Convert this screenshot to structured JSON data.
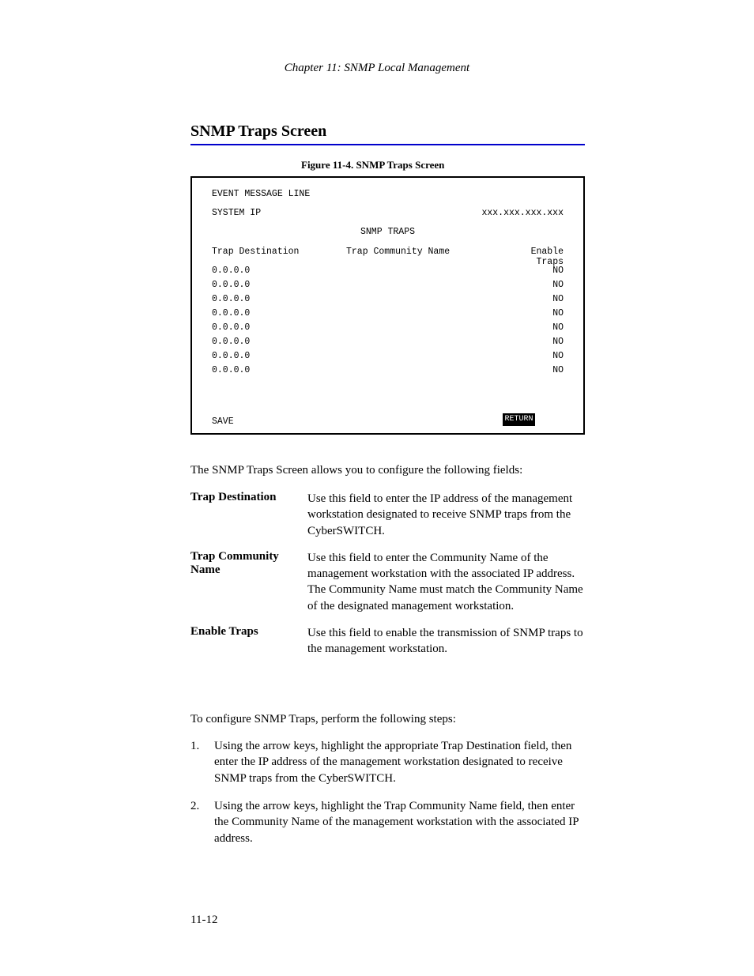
{
  "header": {
    "running": "Chapter 11:  SNMP Local Management"
  },
  "section_title": "SNMP Traps Screen",
  "figure": {
    "caption": "Figure 11-4.  SNMP Traps Screen"
  },
  "screen": {
    "event_message": "EVENT MESSAGE LINE",
    "system_line": {
      "left": "SYSTEM IP",
      "right": "xxx.xxx.xxx.xxx"
    },
    "title_line": "SNMP TRAPS",
    "col_headers": {
      "left": "Trap Destination",
      "mid": "Trap Community Name",
      "right": "Enable Traps"
    },
    "rows": [
      {
        "left": "0.0.0.0",
        "right": "NO"
      },
      {
        "left": "0.0.0.0",
        "right": "NO"
      },
      {
        "left": "0.0.0.0",
        "right": "NO"
      },
      {
        "left": "0.0.0.0",
        "right": "NO"
      },
      {
        "left": "0.0.0.0",
        "right": "NO"
      },
      {
        "left": "0.0.0.0",
        "right": "NO"
      },
      {
        "left": "0.0.0.0",
        "right": "NO"
      },
      {
        "left": "0.0.0.0",
        "right": "NO"
      }
    ],
    "footer_save": "SAVE",
    "return_btn": "RETURN"
  },
  "body": {
    "p1": "The SNMP Traps Screen allows you to configure the following fields:",
    "fields": [
      {
        "label": "Trap Destination",
        "desc": "Use this field to enter the IP address of the management workstation designated to receive SNMP traps from the CyberSWITCH."
      },
      {
        "label": "Trap Community Name",
        "desc": "Use this field to enter the Community Name of the management workstation with the associated IP address. The Community Name must match the Community Name of the designated management workstation."
      },
      {
        "label": "Enable Traps",
        "desc": "Use this field to enable the transmission of SNMP traps to the management workstation."
      }
    ],
    "p2": "To configure SNMP Traps, perform the following steps:",
    "step1_num": "1.",
    "step1_text": "Using the arrow keys, highlight the appropriate Trap Destination field, then enter the IP address of the management workstation designated to receive SNMP traps from the CyberSWITCH.",
    "step2_num": "2.",
    "step2_text": "Using the arrow keys, highlight the Trap Community Name field, then enter the Community Name of the management workstation with the associated IP address."
  },
  "page_number": "11-12"
}
